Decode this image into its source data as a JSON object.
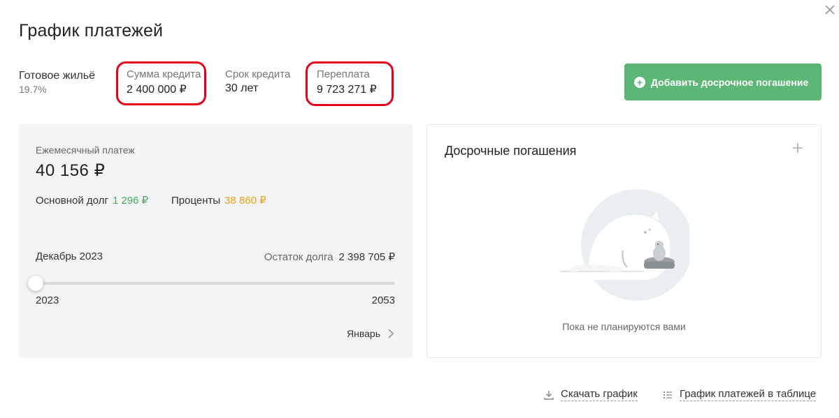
{
  "title": "График платежей",
  "program": {
    "label": "Готовое жильё",
    "rate": "19.7%"
  },
  "loan_amount": {
    "label": "Сумма кредита",
    "value": "2 400 000 ₽"
  },
  "term": {
    "label": "Срок кредита",
    "value": "30 лет"
  },
  "overpayment": {
    "label": "Переплата",
    "value": "9 723 271 ₽"
  },
  "add_button": {
    "label": "Добавить досрочное погашение"
  },
  "monthly": {
    "label": "Ежемесячный платеж",
    "value": "40 156 ₽",
    "principal_label": "Основной долг",
    "principal_value": "1 296 ₽",
    "interest_label": "Проценты",
    "interest_value": "38 860 ₽"
  },
  "timeline": {
    "current_month": "Декабрь 2023",
    "remaining_label": "Остаток долга",
    "remaining_value": "2 398 705 ₽",
    "start_year": "2023",
    "end_year": "2053",
    "slider_position": 0,
    "next_label": "Январь"
  },
  "early": {
    "title": "Досрочные погашения",
    "empty_text": "Пока не планируются вами"
  },
  "footer": {
    "download_label": "Скачать график",
    "table_label": "График платежей в таблице"
  },
  "colors": {
    "accent_green": "#5cb776",
    "principal_green": "#46ab5f",
    "interest_orange": "#f0a017",
    "highlight_red": "#e3001b"
  },
  "icons": [
    "close-icon",
    "plus-circle-icon",
    "chevron-right-icon",
    "plus-icon",
    "download-icon",
    "list-icon",
    "cat-illustration"
  ]
}
